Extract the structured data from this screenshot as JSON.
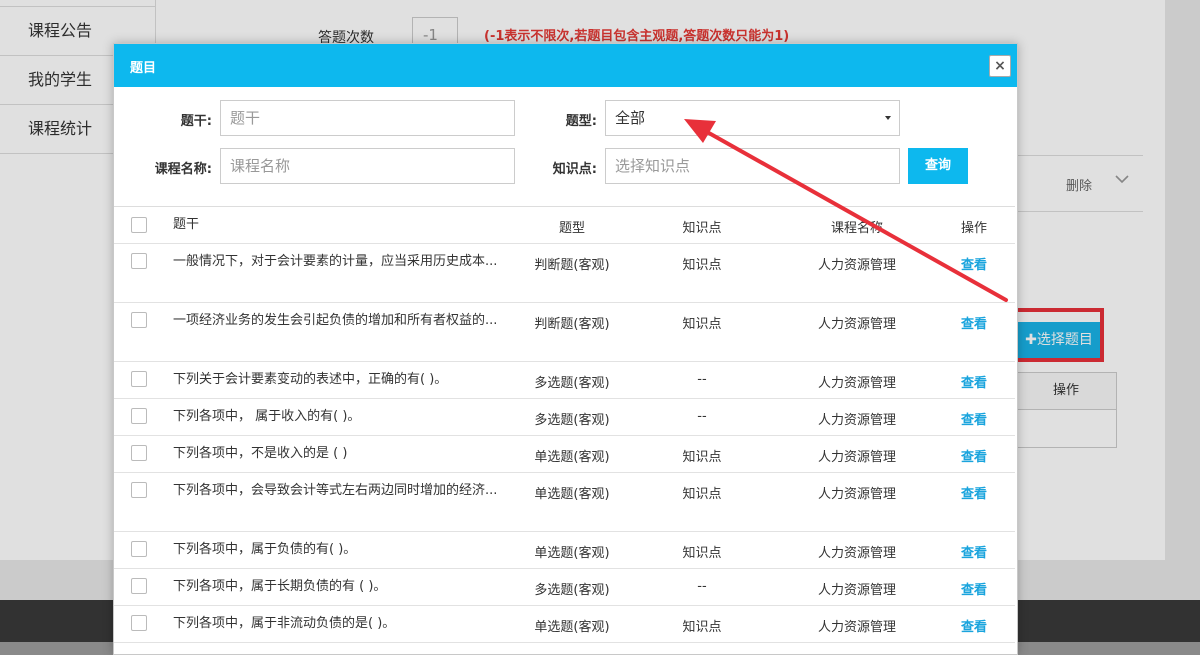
{
  "background": {
    "sidebar": [
      "课程公告",
      "我的学生",
      "课程统计"
    ],
    "answer_count_label": "答题次数",
    "answer_count_value": "-1",
    "answer_count_note": "(-1表示不限次,若题目包含主观题,答题次数只能为1)",
    "delete_label": "删除",
    "select_question_button": "✚选择题目",
    "operation_header": "操作"
  },
  "modal": {
    "title": "题目",
    "close_glyph": "×",
    "filters": {
      "stem_label": "题干:",
      "stem_placeholder": "题干",
      "type_label": "题型:",
      "type_value": "全部",
      "course_label": "课程名称:",
      "course_placeholder": "课程名称",
      "kp_label": "知识点:",
      "kp_placeholder": "选择知识点",
      "query_button": "查询"
    },
    "table": {
      "headers": [
        "题干",
        "题型",
        "知识点",
        "课程名称",
        "操作"
      ],
      "rows": [
        {
          "stem": "一般情况下，对于会计要素的计量，应当采用历史成本...",
          "type": "判断题(客观)",
          "kp": "知识点",
          "course": "人力资源管理",
          "op": "查看"
        },
        {
          "stem": "一项经济业务的发生会引起负债的增加和所有者权益的...",
          "type": "判断题(客观)",
          "kp": "知识点",
          "course": "人力资源管理",
          "op": "查看"
        },
        {
          "stem": "下列关于会计要素变动的表述中，正确的有( )。",
          "type": "多选题(客观)",
          "kp": "--",
          "course": "人力资源管理",
          "op": "查看"
        },
        {
          "stem": "下列各项中，  属于收入的有( )。",
          "type": "多选题(客观)",
          "kp": "--",
          "course": "人力资源管理",
          "op": "查看"
        },
        {
          "stem": "下列各项中，不是收入的是 ( )",
          "type": "单选题(客观)",
          "kp": "知识点",
          "course": "人力资源管理",
          "op": "查看"
        },
        {
          "stem": "下列各项中，会导致会计等式左右两边同时增加的经济...",
          "type": "单选题(客观)",
          "kp": "知识点",
          "course": "人力资源管理",
          "op": "查看"
        },
        {
          "stem": "下列各项中，属于负债的有( )。",
          "type": "单选题(客观)",
          "kp": "知识点",
          "course": "人力资源管理",
          "op": "查看"
        },
        {
          "stem": "下列各项中，属于长期负债的有 ( )。",
          "type": "多选题(客观)",
          "kp": "--",
          "course": "人力资源管理",
          "op": "查看"
        },
        {
          "stem": "下列各项中，属于非流动负债的是( )。",
          "type": "单选题(客观)",
          "kp": "知识点",
          "course": "人力资源管理",
          "op": "查看"
        }
      ]
    }
  },
  "colors": {
    "accent": "#0db8ee",
    "link": "#1aa4dd",
    "annotation_red": "#e8303a"
  }
}
